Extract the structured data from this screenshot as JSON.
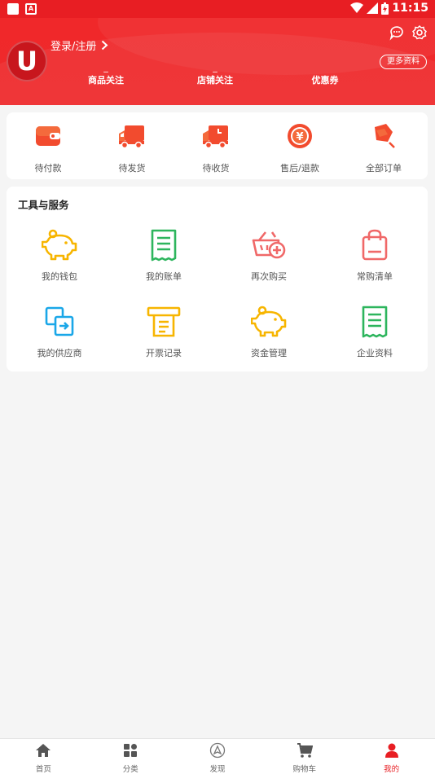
{
  "status_bar": {
    "time": "11:15",
    "notif_icon": "A"
  },
  "header": {
    "avatar_letter": "U",
    "login_label": "登录/注册",
    "more_label": "更多资料",
    "stats": [
      {
        "value": "_",
        "label": "商品关注"
      },
      {
        "value": "_",
        "label": "店铺关注"
      },
      {
        "value": "",
        "label": "优惠券"
      }
    ]
  },
  "orders": [
    {
      "label": "待付款",
      "icon": "wallet-icon"
    },
    {
      "label": "待发货",
      "icon": "truck-icon"
    },
    {
      "label": "待收货",
      "icon": "delivery-icon"
    },
    {
      "label": "售后/退款",
      "icon": "refund-icon"
    },
    {
      "label": "全部订单",
      "icon": "all-orders-icon"
    }
  ],
  "tools": {
    "title": "工具与服务",
    "items": [
      {
        "label": "我的钱包",
        "icon": "piggy-bank-icon",
        "color": "#f7b500"
      },
      {
        "label": "我的账单",
        "icon": "bill-icon",
        "color": "#2db55d"
      },
      {
        "label": "再次购买",
        "icon": "rebuy-basket-icon",
        "color": "#f06868"
      },
      {
        "label": "常购清单",
        "icon": "shopping-bag-icon",
        "color": "#f06868"
      },
      {
        "label": "我的供应商",
        "icon": "supplier-icon",
        "color": "#1aa7e8"
      },
      {
        "label": "开票记录",
        "icon": "invoice-icon",
        "color": "#f7b500"
      },
      {
        "label": "资金管理",
        "icon": "fund-piggy-icon",
        "color": "#f7b500"
      },
      {
        "label": "企业资料",
        "icon": "company-doc-icon",
        "color": "#2db55d"
      }
    ]
  },
  "tabbar": [
    {
      "label": "首页",
      "icon": "home-icon"
    },
    {
      "label": "分类",
      "icon": "category-icon"
    },
    {
      "label": "发现",
      "icon": "discover-icon"
    },
    {
      "label": "购物车",
      "icon": "cart-icon"
    },
    {
      "label": "我的",
      "icon": "profile-icon",
      "active": true
    }
  ],
  "colors": {
    "brand": "#e81e23",
    "accent_orange": "#f24b2e"
  }
}
